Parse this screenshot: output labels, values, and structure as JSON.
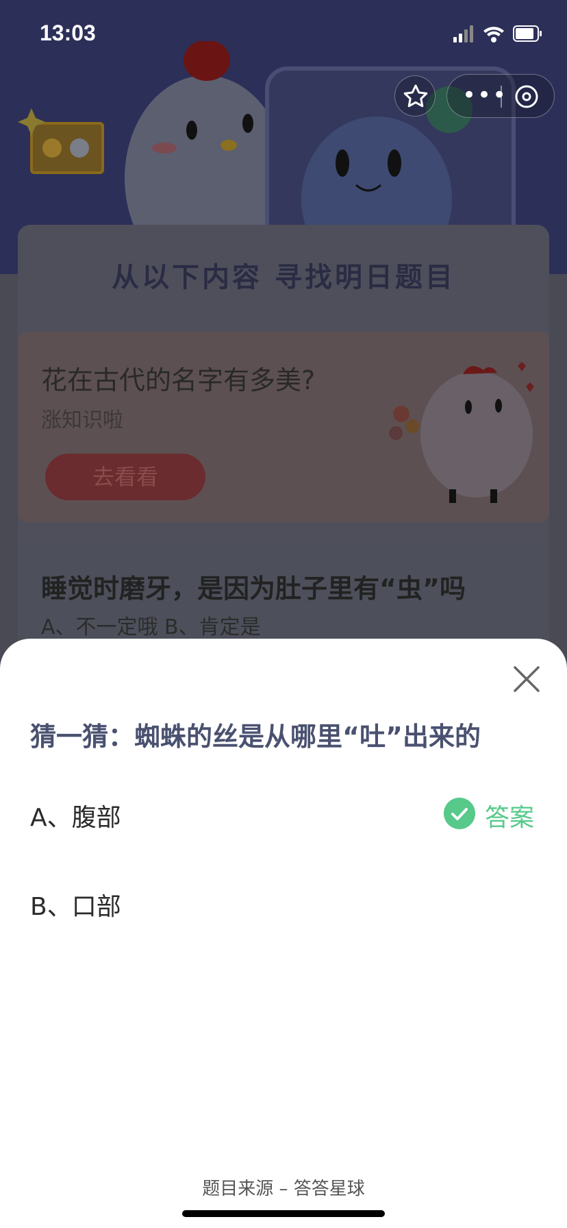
{
  "status_bar": {
    "time": "13:03",
    "signal_icon": "signal-icon",
    "wifi_icon": "wifi-icon",
    "battery_icon": "battery-icon"
  },
  "capsule": {
    "more_icon": "more-dots-icon",
    "close_icon": "close-circle-icon",
    "favorite_icon": "star-icon"
  },
  "panel": {
    "title": "从以下内容 寻找明日题目"
  },
  "card1": {
    "title": "花在古代的名字有多美?",
    "subtitle": "涨知识啦",
    "button_label": "去看看"
  },
  "card2": {
    "question": "睡觉时磨牙，是因为肚子里有“虫”吗",
    "options": "A、不一定哦    B、肯定是"
  },
  "sheet": {
    "question": "猜一猜：蜘蛛的丝是从哪里“吐”出来的",
    "options": [
      {
        "label": "A、腹部",
        "is_answer": true
      },
      {
        "label": "B、口部",
        "is_answer": false
      }
    ],
    "answer_label": "答案",
    "source": "题目来源 – 答答星球",
    "close_icon": "close-icon"
  },
  "colors": {
    "accent_green": "#57c98a",
    "question_text": "#4a5170",
    "overlay_bg": "#2a2d52"
  }
}
